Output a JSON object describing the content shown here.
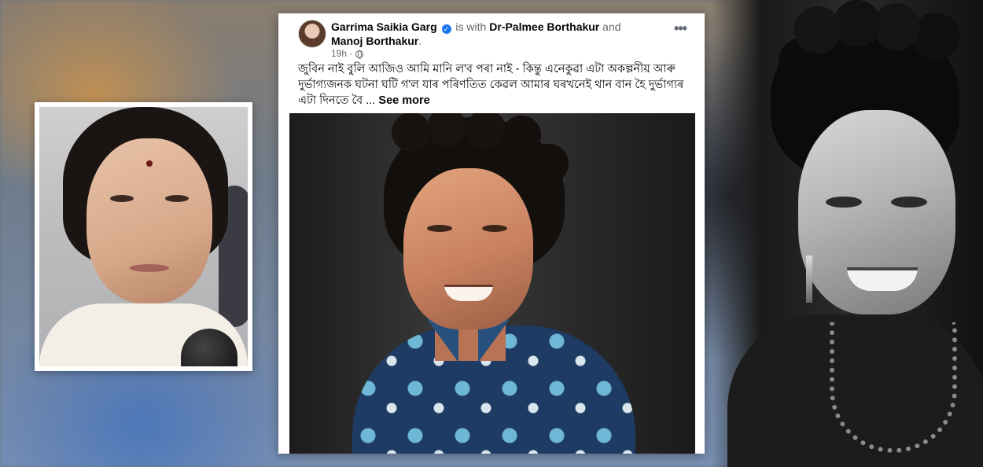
{
  "post": {
    "author": "Garrima Saikia Garg",
    "with_text": "is with",
    "tagged_1": "Dr-Palmee Borthakur",
    "and_text": "and",
    "tagged_2": "Manoj Borthakur",
    "tagged_suffix": ".",
    "time": "19h ·",
    "text": "জুবিন নাই বুলি আজিও আমি মানি ল'ব পৰা নাই -  কিন্তু এনেকুৱা এটা অকল্পনীয় আৰু দুৰ্ভাগ্যজনক ঘটনা ঘটি গ'ল যাৰ পৰিণতিত কেৱল আমাৰ ঘৰখনেই থান বান হৈ  দুৰ্ভাগ্যৰ এটা দিনতে বৈ ...",
    "see_more": "See more",
    "more_icon": "more-dots-icon",
    "verified_icon": "verified-badge-icon",
    "privacy_icon": "globe-icon"
  },
  "colors": {
    "facebook_blue": "#1877f2",
    "text_primary": "#050505",
    "text_secondary": "#65676b"
  }
}
